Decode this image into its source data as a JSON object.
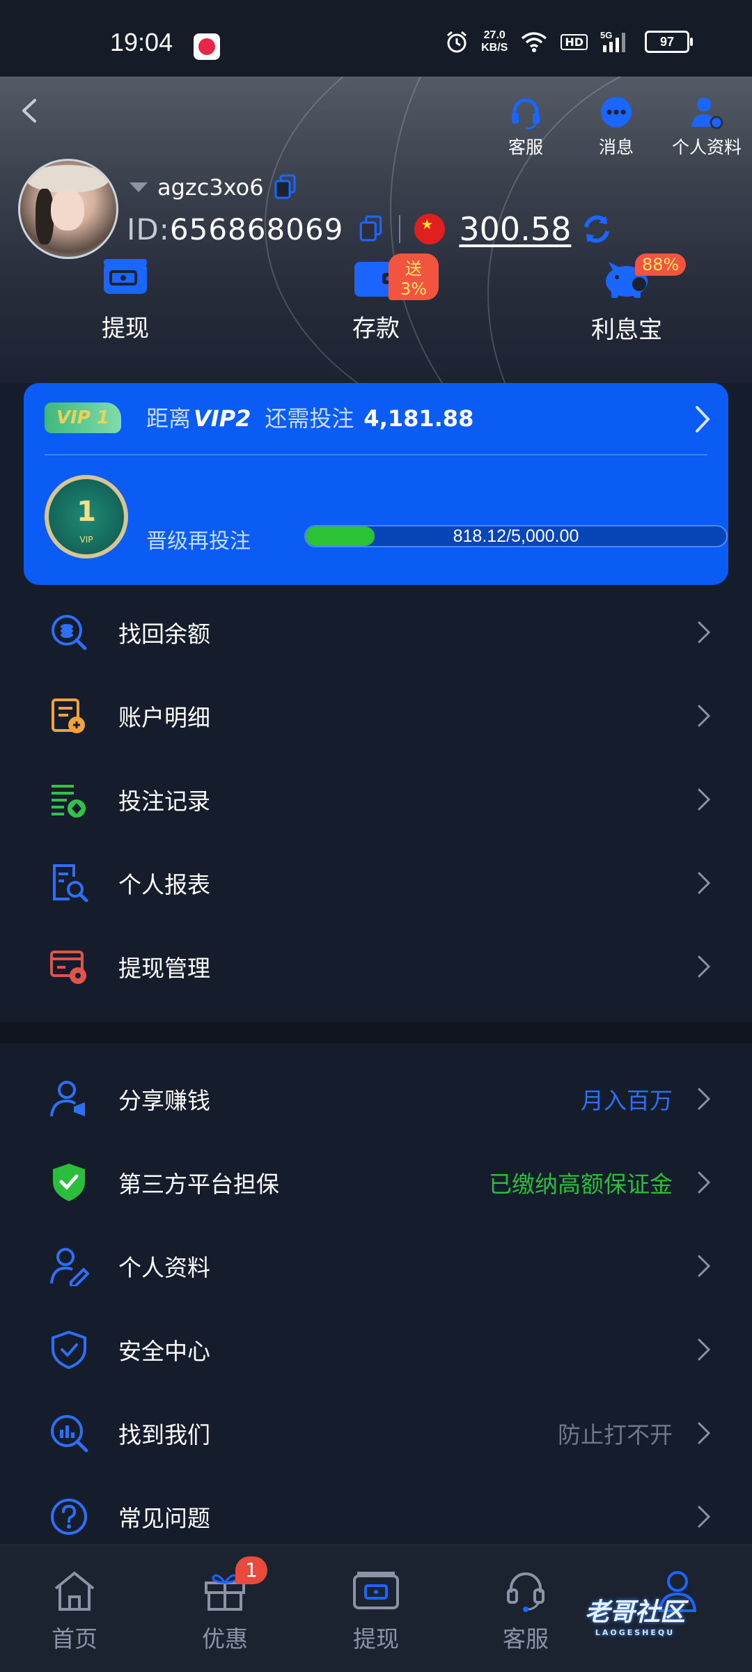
{
  "status_bar": {
    "time": "19:04",
    "net_speed": "27.0",
    "net_unit": "KB/S",
    "hd": "HD",
    "signal": "5G",
    "battery": "97"
  },
  "header": {
    "top_actions": [
      {
        "label": "客服",
        "icon": "headset-icon"
      },
      {
        "label": "消息",
        "icon": "message-icon"
      },
      {
        "label": "个人资料",
        "icon": "user-icon"
      }
    ],
    "username": "agzc3xo6",
    "id_label": "ID:",
    "id_value": "656868069",
    "balance": "300.58",
    "quick_actions": [
      {
        "label": "提现",
        "badge": ""
      },
      {
        "label": "存款",
        "badge": "送3%"
      },
      {
        "label": "利息宝",
        "badge": "88%"
      }
    ]
  },
  "vip": {
    "level_pill": "VIP 1",
    "distance_label": "距离",
    "next_level": "VIP2",
    "need_label": "还需投注",
    "need_amount": "4,181.88",
    "badge_number": "1",
    "badge_caption": "VIP",
    "upgrade_label": "晋级再投注",
    "progress_text": "818.12/5,000.00",
    "progress_fraction": 0.164
  },
  "menu_group_1": [
    {
      "label": "找回余额",
      "icon": "recover-balance-icon",
      "color": "#2f6ff5"
    },
    {
      "label": "账户明细",
      "icon": "account-details-icon",
      "color": "#f2a23a"
    },
    {
      "label": "投注记录",
      "icon": "bet-records-icon",
      "color": "#31c24a"
    },
    {
      "label": "个人报表",
      "icon": "personal-report-icon",
      "color": "#2f6ff5"
    },
    {
      "label": "提现管理",
      "icon": "withdraw-manage-icon",
      "color": "#e2544a"
    }
  ],
  "menu_group_2": [
    {
      "label": "分享赚钱",
      "extra": "月入百万",
      "extra_color": "#2f6ff5",
      "icon": "share-earn-icon"
    },
    {
      "label": "第三方平台担保",
      "extra": "已缴纳高额保证金",
      "extra_color": "#2bbd3c",
      "icon": "guarantee-shield-icon"
    },
    {
      "label": "个人资料",
      "extra": "",
      "extra_color": "",
      "icon": "profile-edit-icon"
    },
    {
      "label": "安全中心",
      "extra": "",
      "extra_color": "",
      "icon": "security-shield-icon"
    },
    {
      "label": "找到我们",
      "extra": "防止打不开",
      "extra_color": "#6f7888",
      "icon": "find-us-icon"
    },
    {
      "label": "常见问题",
      "extra": "",
      "extra_color": "",
      "icon": "faq-icon"
    }
  ],
  "bottom_nav": [
    {
      "label": "首页",
      "icon": "home-icon",
      "badge": ""
    },
    {
      "label": "优惠",
      "icon": "gift-icon",
      "badge": "1"
    },
    {
      "label": "提现",
      "icon": "withdraw-icon",
      "badge": ""
    },
    {
      "label": "客服",
      "icon": "headset-icon",
      "badge": ""
    },
    {
      "label": "",
      "icon": "profile-icon",
      "badge": ""
    }
  ],
  "watermark": {
    "text": "老哥社区",
    "sub": "LAOGESHEQU"
  },
  "colors": {
    "accent": "#1a66ff",
    "vip_card": "#0b5cf5",
    "background": "#151c2b"
  }
}
